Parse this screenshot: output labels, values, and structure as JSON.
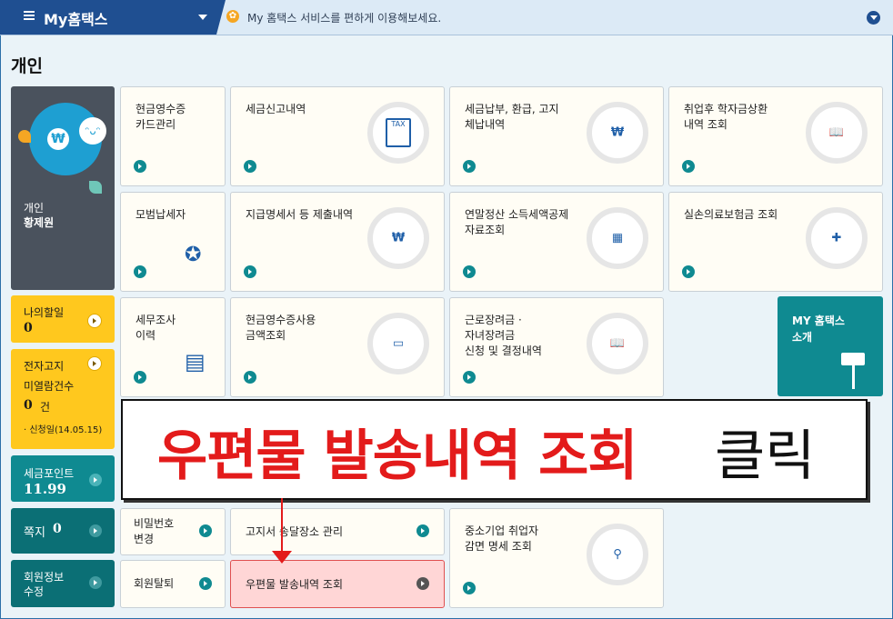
{
  "topbar": {
    "brand_title": "My홈택스",
    "notice": "My 홈택스 서비스를 편하게 이용해보세요."
  },
  "section_title": "개인",
  "profile": {
    "line1": "개인",
    "line2": "황제원"
  },
  "side": {
    "discount": {
      "label": "나의할일",
      "value": "0"
    },
    "ebill": {
      "label1": "전자고지",
      "label2": "미열람건수",
      "value": "0",
      "unit": "건",
      "note": "· 신청일(14.05.15)"
    },
    "points": {
      "label": "세금포인트",
      "value": "11.99"
    },
    "memo": {
      "label": "쪽지",
      "value": "0"
    },
    "member": {
      "label1": "회원정보",
      "label2": "수정"
    }
  },
  "tiles": {
    "r1": [
      "현금영수증\n카드관리",
      "세금신고내역",
      "세금납부, 환급, 고지\n체납내역",
      "취업후 학자금상환\n내역 조회"
    ],
    "r2": [
      "모범납세자",
      "지급명세서 등 제출내역",
      "연말정산 소득세액공제\n자료조회",
      "실손의료보험금 조회"
    ],
    "r3": [
      "세무조사\n이력",
      "현금영수증사용\n금액조회",
      "근로장려금 ·\n자녀장려금\n신청 및 결정내역"
    ],
    "password": "비밀번호\n변경",
    "notice_place": "고지서 송달장소 관리",
    "sme": "중소기업 취업자\n감면 명세 조회",
    "withdraw": "회원탈퇴",
    "mail_history": "우편물 발송내역 조회"
  },
  "icons": {
    "tax_doc": "TAX"
  },
  "mytx": {
    "label1": "MY 홈택스",
    "label2": "소개"
  },
  "callout": {
    "red_text": "우편물 발송내역 조회",
    "black_text": "클릭"
  },
  "colors": {
    "brand": "#1f4f91",
    "teal": "#0f8a91",
    "yellow": "#ffc81e",
    "red": "#e31b1b"
  }
}
